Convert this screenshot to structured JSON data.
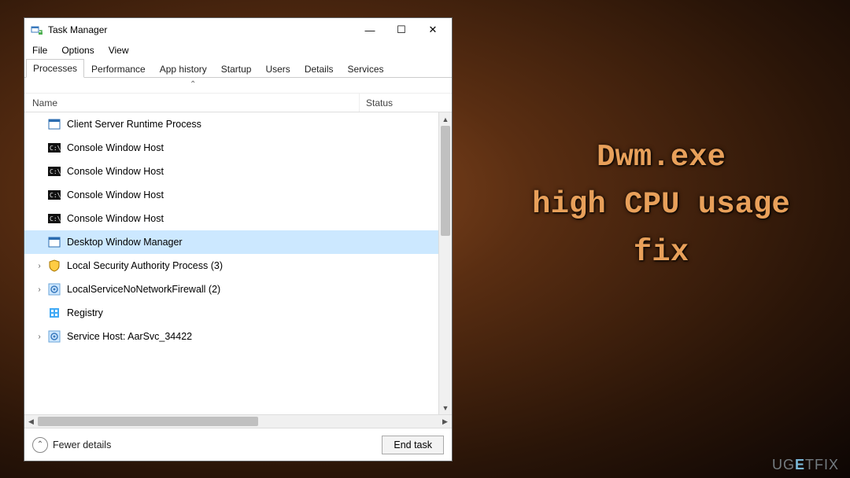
{
  "window": {
    "title": "Task Manager",
    "controls": {
      "min": "—",
      "max": "☐",
      "close": "✕"
    }
  },
  "menu": {
    "file": "File",
    "options": "Options",
    "view": "View"
  },
  "tabs": {
    "processes": "Processes",
    "performance": "Performance",
    "app_history": "App history",
    "startup": "Startup",
    "users": "Users",
    "details": "Details",
    "services": "Services"
  },
  "columns": {
    "name": "Name",
    "status": "Status"
  },
  "processes": [
    {
      "icon": "window-blue",
      "name": "Client Server Runtime Process",
      "expandable": false,
      "selected": false
    },
    {
      "icon": "console",
      "name": "Console Window Host",
      "expandable": false,
      "selected": false
    },
    {
      "icon": "console",
      "name": "Console Window Host",
      "expandable": false,
      "selected": false
    },
    {
      "icon": "console",
      "name": "Console Window Host",
      "expandable": false,
      "selected": false
    },
    {
      "icon": "console",
      "name": "Console Window Host",
      "expandable": false,
      "selected": false
    },
    {
      "icon": "window-blue",
      "name": "Desktop Window Manager",
      "expandable": false,
      "selected": true
    },
    {
      "icon": "shield",
      "name": "Local Security Authority Process (3)",
      "expandable": true,
      "selected": false
    },
    {
      "icon": "gear",
      "name": "LocalServiceNoNetworkFirewall (2)",
      "expandable": true,
      "selected": false
    },
    {
      "icon": "registry",
      "name": "Registry",
      "expandable": false,
      "selected": false
    },
    {
      "icon": "gear",
      "name": "Service Host: AarSvc_34422",
      "expandable": true,
      "selected": false
    }
  ],
  "footer": {
    "fewer": "Fewer details",
    "endtask": "End task"
  },
  "caption": {
    "line1": "Dwm.exe",
    "line2": "high CPU usage",
    "line3": "fix"
  },
  "watermark": "UGETFIX"
}
